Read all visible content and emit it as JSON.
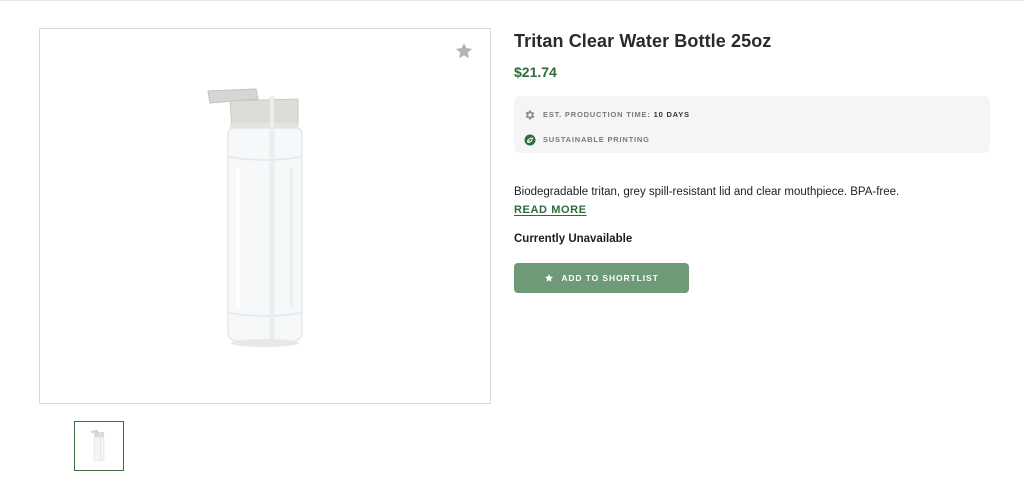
{
  "product": {
    "title": "Tritan Clear Water Bottle 25oz",
    "price": "$21.74",
    "production_label": "EST. PRODUCTION TIME:",
    "production_value": "10 DAYS",
    "sustainable_label": "SUSTAINABLE PRINTING",
    "description": "Biodegradable tritan, grey spill-resistant lid and clear mouthpiece. BPA-free.",
    "read_more": "READ MORE",
    "availability": "Currently Unavailable"
  },
  "actions": {
    "shortlist_label": "ADD TO SHORTLIST"
  },
  "icons": {
    "favorite": "star-icon",
    "production": "gear-icon",
    "sustainable": "leaf-icon",
    "shortlist": "star-icon"
  },
  "colors": {
    "accent_green": "#2f6b3a",
    "button_green": "#6e9a77",
    "meta_background": "#f5f5f5"
  }
}
